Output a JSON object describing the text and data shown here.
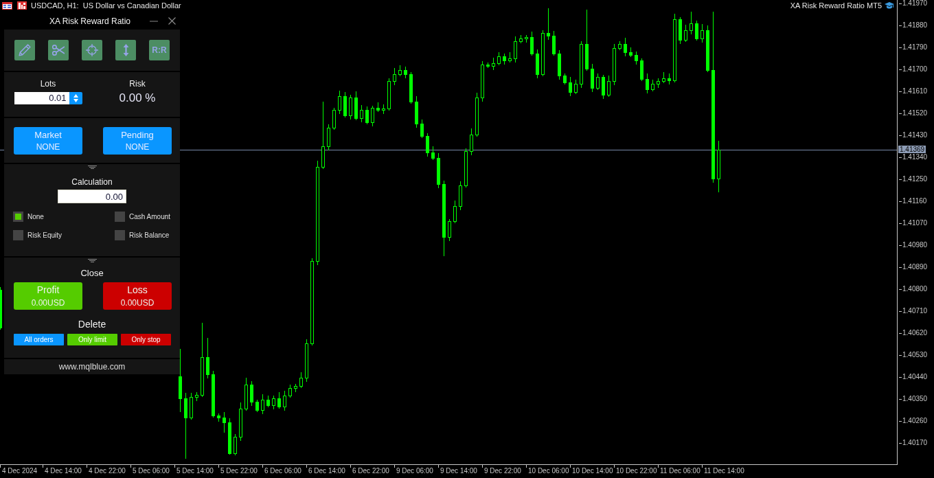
{
  "chart_header": {
    "symbol": "USDCAD, H1:",
    "description": "US Dollar vs Canadian Dollar",
    "indicator": "XA Risk Reward Ratio MT5"
  },
  "panel": {
    "title": "XA Risk Reward Ratio",
    "tools": [
      {
        "kind": "pencil"
      },
      {
        "kind": "scissors"
      },
      {
        "kind": "crosshair"
      },
      {
        "kind": "arrows"
      },
      {
        "kind": "text",
        "label": "R:R"
      }
    ],
    "lots": {
      "label": "Lots",
      "value": "0.01"
    },
    "risk": {
      "label": "Risk",
      "value": "0.00 %"
    },
    "orders": [
      {
        "label": "Market",
        "value": "NONE"
      },
      {
        "label": "Pending",
        "value": "NONE"
      }
    ],
    "calculation": {
      "label": "Calculation",
      "value": "0.00",
      "options": [
        {
          "label": "None",
          "selected": true
        },
        {
          "label": "Cash Amount",
          "selected": false
        },
        {
          "label": "Risk Equity",
          "selected": false
        },
        {
          "label": "Risk Balance",
          "selected": false
        }
      ]
    },
    "close": {
      "label": "Close",
      "buttons": [
        {
          "label": "Profit",
          "value": "0.00USD",
          "color": "#55cc00"
        },
        {
          "label": "Loss",
          "value": "0.00USD",
          "color": "#cc0000"
        }
      ]
    },
    "delete": {
      "label": "Delete",
      "buttons": [
        {
          "label": "All orders",
          "color": "#0a96ff"
        },
        {
          "label": "Only limit",
          "color": "#55cc00"
        },
        {
          "label": "Only stop",
          "color": "#cc0000"
        }
      ]
    },
    "footer": "www.mqlblue.com"
  },
  "price_axis": {
    "labels": [
      "1.41970",
      "1.41880",
      "1.41790",
      "1.41700",
      "1.41610",
      "1.41520",
      "1.41430",
      "1.41340",
      "1.41250",
      "1.41160",
      "1.41070",
      "1.40980",
      "1.40890",
      "1.40800",
      "1.40710",
      "1.40620",
      "1.40530",
      "1.40440",
      "1.40350",
      "1.40260",
      "1.40170"
    ],
    "current_price": "1.41369"
  },
  "time_axis": {
    "labels": [
      "4 Dec 2024",
      "4 Dec 14:00",
      "4 Dec 22:00",
      "5 Dec 06:00",
      "5 Dec 14:00",
      "5 Dec 22:00",
      "6 Dec 06:00",
      "6 Dec 14:00",
      "6 Dec 22:00",
      "9 Dec 06:00",
      "9 Dec 14:00",
      "9 Dec 22:00",
      "10 Dec 06:00",
      "10 Dec 14:00",
      "10 Dec 22:00",
      "11 Dec 06:00",
      "11 Dec 14:00"
    ]
  }
}
